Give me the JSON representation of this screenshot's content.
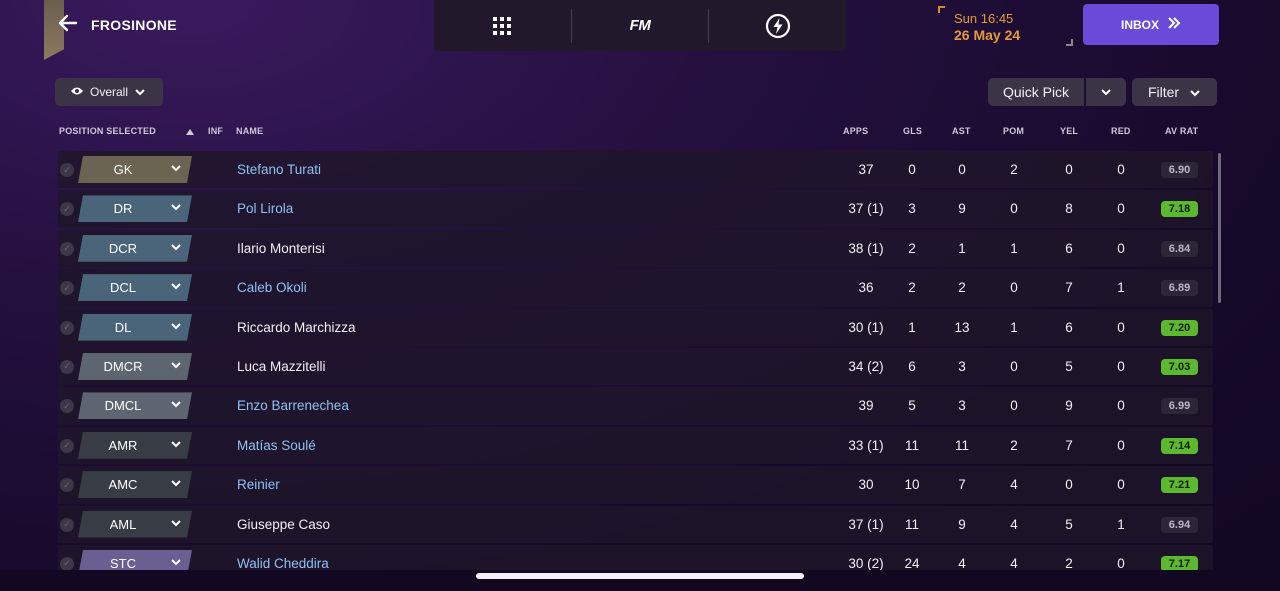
{
  "header": {
    "club_name": "FROSINONE",
    "date_time": "Sun 16:45",
    "date_day": "26 May 24",
    "inbox_label": "INBOX",
    "nav": [
      {
        "icon": "grid-menu-icon"
      },
      {
        "label": "FM"
      },
      {
        "icon": "lightning-icon"
      }
    ]
  },
  "toolbar": {
    "view_label": "Overall",
    "quick_pick_label": "Quick Pick",
    "filter_label": "Filter"
  },
  "columns": {
    "position": "POSITION SELECTED",
    "inf": "INF",
    "name": "NAME",
    "apps": "APPS",
    "gls": "GLS",
    "ast": "AST",
    "pom": "POM",
    "yel": "YEL",
    "red": "RED",
    "av_rat": "AV RAT"
  },
  "colors": {
    "gk": "#6b6452",
    "defender": "#4a6479",
    "midfield": "#5d6670",
    "attack": "#383d45",
    "striker": "#6a5f92",
    "rating_green": "#5bb82f",
    "inbox": "#6a4ad8"
  },
  "players": [
    {
      "pos": "GK",
      "group": "gk",
      "name": "Stefano Turati",
      "link": true,
      "apps": "37",
      "gls": "0",
      "ast": "0",
      "pom": "2",
      "yel": "0",
      "red": "0",
      "rat": "6.90",
      "highlight": false
    },
    {
      "pos": "DR",
      "group": "defender",
      "name": "Pol Lirola",
      "link": true,
      "apps": "37 (1)",
      "gls": "3",
      "ast": "9",
      "pom": "0",
      "yel": "8",
      "red": "0",
      "rat": "7.18",
      "highlight": true
    },
    {
      "pos": "DCR",
      "group": "defender",
      "name": "Ilario Monterisi",
      "link": false,
      "apps": "38 (1)",
      "gls": "2",
      "ast": "1",
      "pom": "1",
      "yel": "6",
      "red": "0",
      "rat": "6.84",
      "highlight": false
    },
    {
      "pos": "DCL",
      "group": "defender",
      "name": "Caleb Okoli",
      "link": true,
      "apps": "36",
      "gls": "2",
      "ast": "2",
      "pom": "0",
      "yel": "7",
      "red": "1",
      "rat": "6.89",
      "highlight": false
    },
    {
      "pos": "DL",
      "group": "defender",
      "name": "Riccardo Marchizza",
      "link": false,
      "apps": "30 (1)",
      "gls": "1",
      "ast": "13",
      "pom": "1",
      "yel": "6",
      "red": "0",
      "rat": "7.20",
      "highlight": true
    },
    {
      "pos": "DMCR",
      "group": "midfield",
      "name": "Luca Mazzitelli",
      "link": false,
      "apps": "34 (2)",
      "gls": "6",
      "ast": "3",
      "pom": "0",
      "yel": "5",
      "red": "0",
      "rat": "7.03",
      "highlight": true
    },
    {
      "pos": "DMCL",
      "group": "midfield",
      "name": "Enzo Barrenechea",
      "link": true,
      "apps": "39",
      "gls": "5",
      "ast": "3",
      "pom": "0",
      "yel": "9",
      "red": "0",
      "rat": "6.99",
      "highlight": false
    },
    {
      "pos": "AMR",
      "group": "attack",
      "name": "Matías Soulé",
      "link": true,
      "apps": "33 (1)",
      "gls": "11",
      "ast": "11",
      "pom": "2",
      "yel": "7",
      "red": "0",
      "rat": "7.14",
      "highlight": true
    },
    {
      "pos": "AMC",
      "group": "attack",
      "name": "Reinier",
      "link": true,
      "apps": "30",
      "gls": "10",
      "ast": "7",
      "pom": "4",
      "yel": "0",
      "red": "0",
      "rat": "7.21",
      "highlight": true
    },
    {
      "pos": "AML",
      "group": "attack",
      "name": "Giuseppe Caso",
      "link": false,
      "apps": "37 (1)",
      "gls": "11",
      "ast": "9",
      "pom": "4",
      "yel": "5",
      "red": "1",
      "rat": "6.94",
      "highlight": false
    },
    {
      "pos": "STC",
      "group": "striker",
      "name": "Walid Cheddira",
      "link": true,
      "apps": "30 (2)",
      "gls": "24",
      "ast": "4",
      "pom": "4",
      "yel": "2",
      "red": "0",
      "rat": "7.17",
      "highlight": true
    }
  ]
}
